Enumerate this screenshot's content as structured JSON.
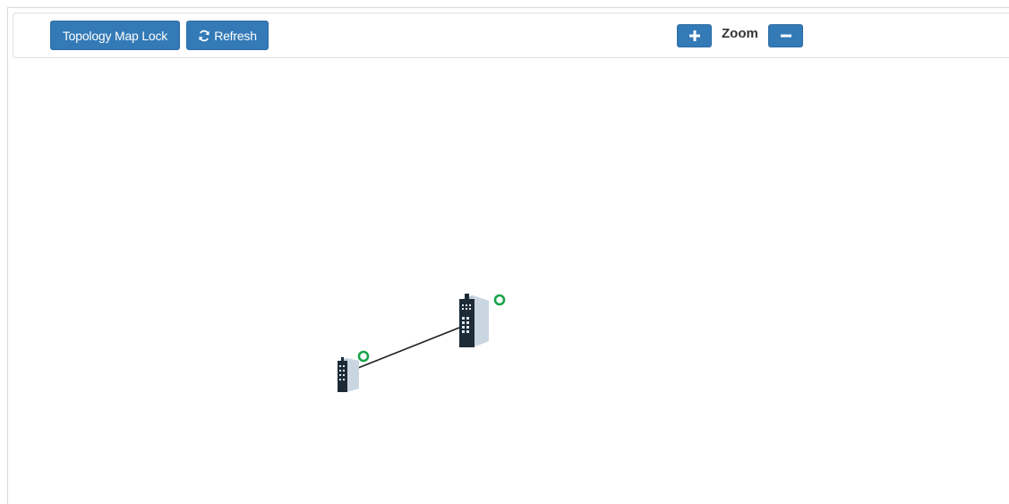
{
  "toolbar": {
    "lock_label": "Topology Map Lock",
    "refresh_label": "Refresh",
    "refresh_icon": "refresh-icon",
    "zoom_label": "Zoom",
    "zoom_in_icon": "plus-icon",
    "zoom_out_icon": "minus-icon"
  },
  "topology": {
    "devices": [
      {
        "id": "switch-small",
        "icon": "industrial-switch-icon",
        "status": "online",
        "status_color": "#1aa34a"
      },
      {
        "id": "switch-large",
        "icon": "industrial-switch-icon",
        "status": "online",
        "status_color": "#1aa34a"
      }
    ],
    "links": [
      {
        "from": "switch-small",
        "to": "switch-large"
      }
    ]
  },
  "colors": {
    "button": "#337ab7",
    "device_dark": "#1d2b36",
    "device_side": "#b9c8d6",
    "status_online": "#1aa34a"
  }
}
